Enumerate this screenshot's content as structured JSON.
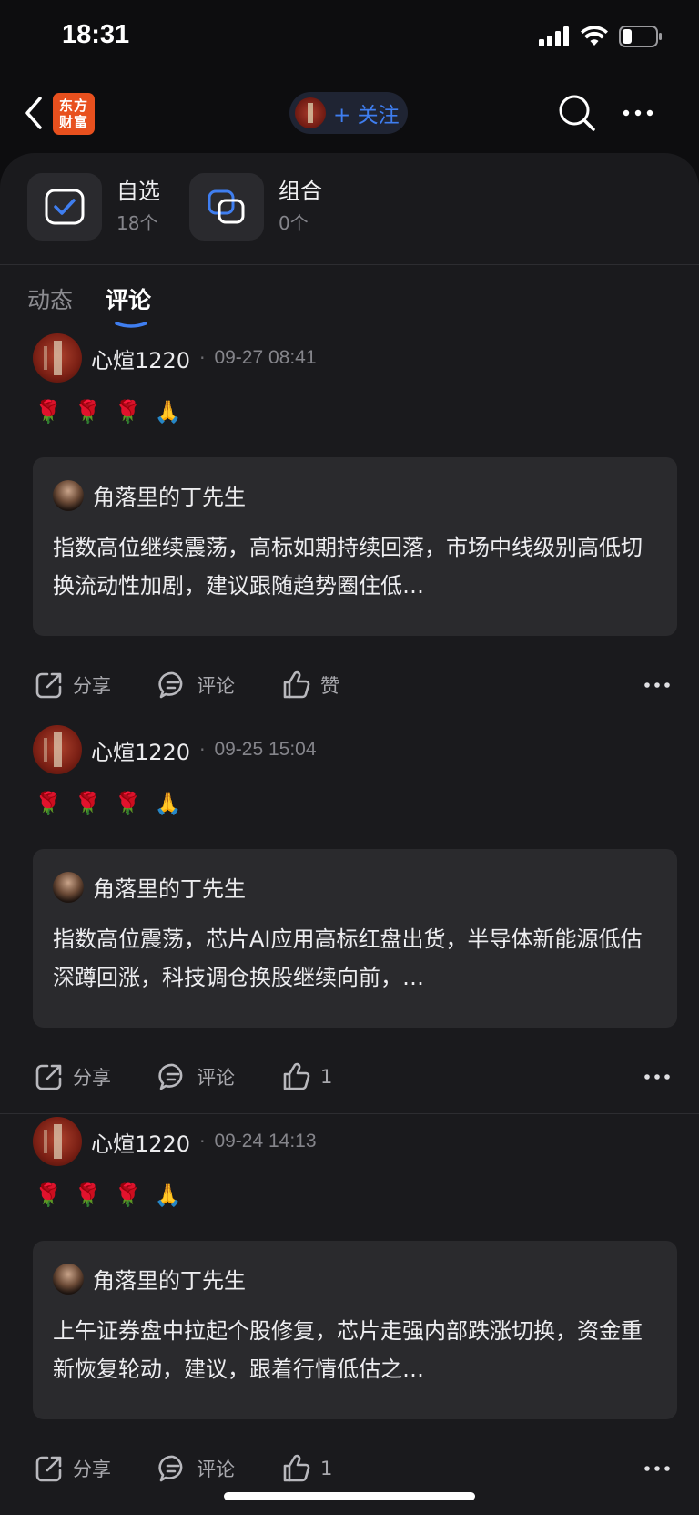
{
  "status": {
    "time": "18:31"
  },
  "nav": {
    "logo_text": "东方财富",
    "follow_label": "+ 关注"
  },
  "quick": [
    {
      "title": "自选",
      "count": "18个"
    },
    {
      "title": "组合",
      "count": "0个"
    }
  ],
  "tabs": [
    {
      "label": "动态",
      "active": false
    },
    {
      "label": "评论",
      "active": true
    }
  ],
  "posts": [
    {
      "username": "心煊1220",
      "time": "09-27 08:41",
      "emojis": [
        "🌹",
        "🌹",
        "🌹",
        "🙏"
      ],
      "quote_author": "角落里的丁先生",
      "quote_text": "指数高位继续震荡，高标如期持续回落，市场中线级别高低切换流动性加剧，建议跟随趋势圈住低…",
      "share": "分享",
      "comment": "评论",
      "like": "赞"
    },
    {
      "username": "心煊1220",
      "time": "09-25 15:04",
      "emojis": [
        "🌹",
        "🌹",
        "🌹",
        "🙏"
      ],
      "quote_author": "角落里的丁先生",
      "quote_text": "指数高位震荡，芯片AI应用高标红盘出货，半导体新能源低估深蹲回涨，科技调仓换股继续向前，…",
      "share": "分享",
      "comment": "评论",
      "like": "1"
    },
    {
      "username": "心煊1220",
      "time": "09-24 14:13",
      "emojis": [
        "🌹",
        "🌹",
        "🌹",
        "🙏"
      ],
      "quote_author": "角落里的丁先生",
      "quote_text": "上午证券盘中拉起个股修复，芯片走强内部跌涨切换，资金重新恢复轮动，建议，跟着行情低估之…",
      "share": "分享",
      "comment": "评论",
      "like": "1"
    }
  ],
  "colors": {
    "accent": "#3f7ef0",
    "brand": "#e8501e",
    "background": "#1a1a1d"
  }
}
